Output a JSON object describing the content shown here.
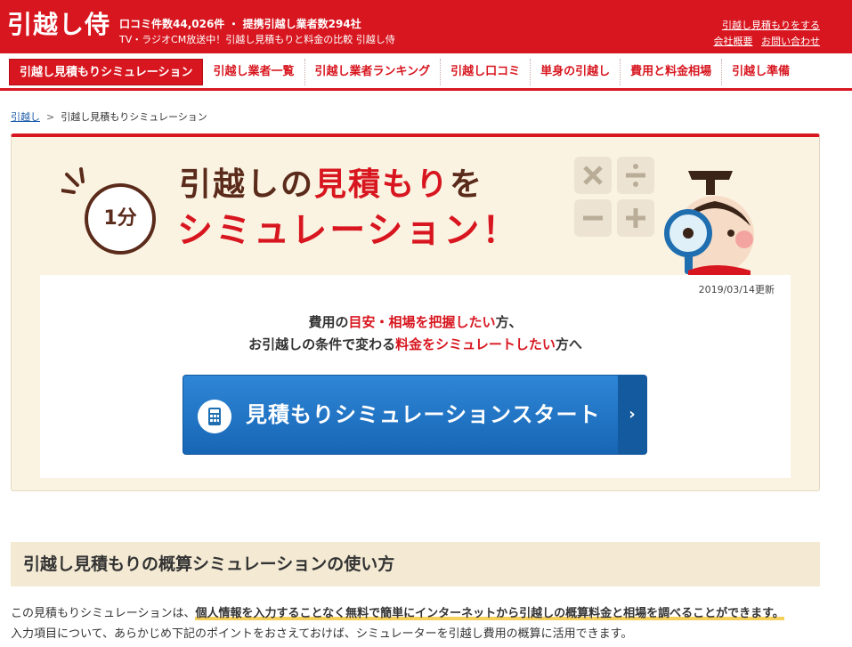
{
  "header": {
    "logo": "引越し侍",
    "tagline1": "口コミ件数44,026件 ・ 提携引越し業者数294社",
    "tagline2": "TV・ラジオCM放送中！引越し見積もりと料金の比較 引越し侍",
    "link_estimate": "引越し見積もりをする",
    "link_company": "会社概要",
    "link_contact": "お問い合わせ"
  },
  "nav": [
    "引越し見積もりシミュレーション",
    "引越し業者一覧",
    "引越し業者ランキング",
    "引越し口コミ",
    "単身の引越し",
    "費用と料金相場",
    "引越し準備"
  ],
  "breadcrumb": {
    "home": "引越し",
    "sep": ">",
    "current": "引越し見積もりシミュレーション"
  },
  "hero": {
    "badge": "1分",
    "title_part1": "引越しの",
    "title_em": "見積もり",
    "title_part2": "を",
    "title_line2": "シミュレーション！",
    "date": "2019/03/14更新",
    "lead1_a": "費用の",
    "lead1_b": "目安・相場を把握したい",
    "lead1_c": "方、",
    "lead2_a": "お引越しの条件で変わる",
    "lead2_b": "料金をシミュレートしたい",
    "lead2_c": "方へ",
    "start_button": "見積もりシミュレーションスタート",
    "start_arrow": "›"
  },
  "section": {
    "title": "引越し見積もりの概算シミュレーションの使い方",
    "body1_a": "この見積もりシミュレーションは、",
    "body1_hl": "個人情報を入力することなく無料で簡単にインターネットから引越しの概算料金と相場を調べることができます。",
    "body2": "入力項目について、あらかじめ下記のポイントをおさえておけば、シミュレーターを引越し費用の概算に活用できます。"
  },
  "colors": {
    "brand_red": "#d8161f",
    "button_blue": "#1f77c8",
    "section_beige": "#f4ead4"
  }
}
